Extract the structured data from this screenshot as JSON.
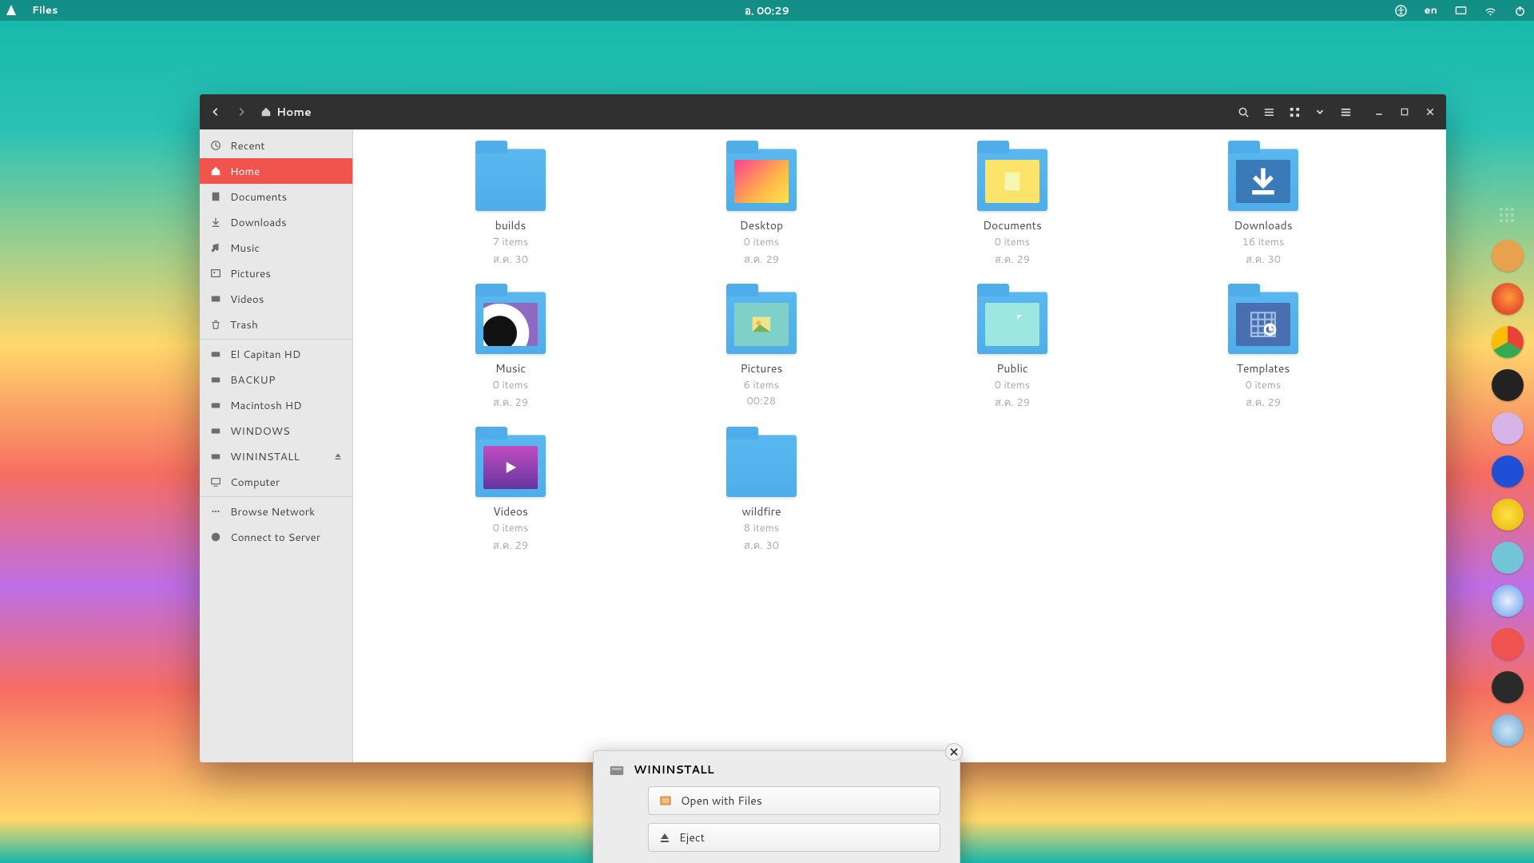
{
  "panel": {
    "app_name": "Files",
    "clock": "อ. 00:29",
    "lang": "en"
  },
  "window": {
    "path_label": "Home"
  },
  "sidebar": {
    "items": [
      {
        "label": "Recent",
        "icon": "clock",
        "active": false
      },
      {
        "label": "Home",
        "icon": "home",
        "active": true
      },
      {
        "label": "Documents",
        "icon": "doc",
        "active": false
      },
      {
        "label": "Downloads",
        "icon": "down",
        "active": false
      },
      {
        "label": "Music",
        "icon": "music",
        "active": false
      },
      {
        "label": "Pictures",
        "icon": "picture",
        "active": false
      },
      {
        "label": "Videos",
        "icon": "video",
        "active": false
      },
      {
        "label": "Trash",
        "icon": "trash",
        "active": false
      }
    ],
    "devices": [
      {
        "label": "El Capitan HD"
      },
      {
        "label": "BACKUP"
      },
      {
        "label": "Macintosh HD"
      },
      {
        "label": "WINDOWS"
      },
      {
        "label": "WININSTALL",
        "ejectable": true
      },
      {
        "label": "Computer"
      }
    ],
    "network": [
      {
        "label": "Browse Network"
      },
      {
        "label": "Connect to Server"
      }
    ]
  },
  "folders": [
    {
      "name": "builds",
      "count": "7 items",
      "date": "ส.ค. 30",
      "kind": "plain"
    },
    {
      "name": "Desktop",
      "count": "0 items",
      "date": "ส.ค. 29",
      "kind": "desktop"
    },
    {
      "name": "Documents",
      "count": "0 items",
      "date": "ส.ค. 29",
      "kind": "documents"
    },
    {
      "name": "Downloads",
      "count": "16 items",
      "date": "ส.ค. 30",
      "kind": "downloads"
    },
    {
      "name": "Music",
      "count": "0 items",
      "date": "ส.ค. 29",
      "kind": "music"
    },
    {
      "name": "Pictures",
      "count": "6 items",
      "date": "00:28",
      "kind": "pictures"
    },
    {
      "name": "Public",
      "count": "0 items",
      "date": "ส.ค. 29",
      "kind": "public"
    },
    {
      "name": "Templates",
      "count": "0 items",
      "date": "ส.ค. 29",
      "kind": "templates"
    },
    {
      "name": "Videos",
      "count": "0 items",
      "date": "ส.ค. 29",
      "kind": "videos"
    },
    {
      "name": "wildfire",
      "count": "8 items",
      "date": "ส.ค. 30",
      "kind": "plain"
    }
  ],
  "notification": {
    "title": "WININSTALL",
    "open_label": "Open with Files",
    "eject_label": "Eject"
  },
  "colors": {
    "accent": "#f0544c"
  }
}
